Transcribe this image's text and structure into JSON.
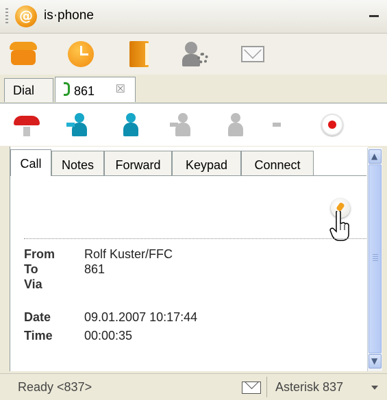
{
  "window": {
    "title": "is·phone",
    "minimize_label": "–"
  },
  "main_toolbar": {
    "icons": [
      "phone-icon",
      "clock-icon",
      "address-book-icon",
      "settings-icon",
      "mail-icon"
    ]
  },
  "top_tabs": [
    {
      "label": "Dial"
    },
    {
      "label": "861",
      "close": "☒"
    }
  ],
  "call_toolbar": {
    "icons": [
      "hangup-icon",
      "transfer-icon",
      "consult-transfer-icon",
      "conference-icon",
      "conference-join-icon",
      "handset-icon",
      "record-icon"
    ]
  },
  "inner_tabs": [
    {
      "label": "Call",
      "active": true
    },
    {
      "label": "Notes"
    },
    {
      "label": "Forward"
    },
    {
      "label": "Keypad"
    },
    {
      "label": "Connect"
    }
  ],
  "call_info": {
    "from_label": "From",
    "from_value": "Rolf Kuster/FFC",
    "to_label": "To",
    "to_value": "861",
    "via_label": "Via",
    "via_value": "",
    "date_label": "Date",
    "date_value": "09.01.2007 10:17:44",
    "time_label": "Time",
    "time_value": "00:00:35"
  },
  "statusbar": {
    "status_text": "Ready <837>",
    "server_label": "Asterisk 837"
  }
}
